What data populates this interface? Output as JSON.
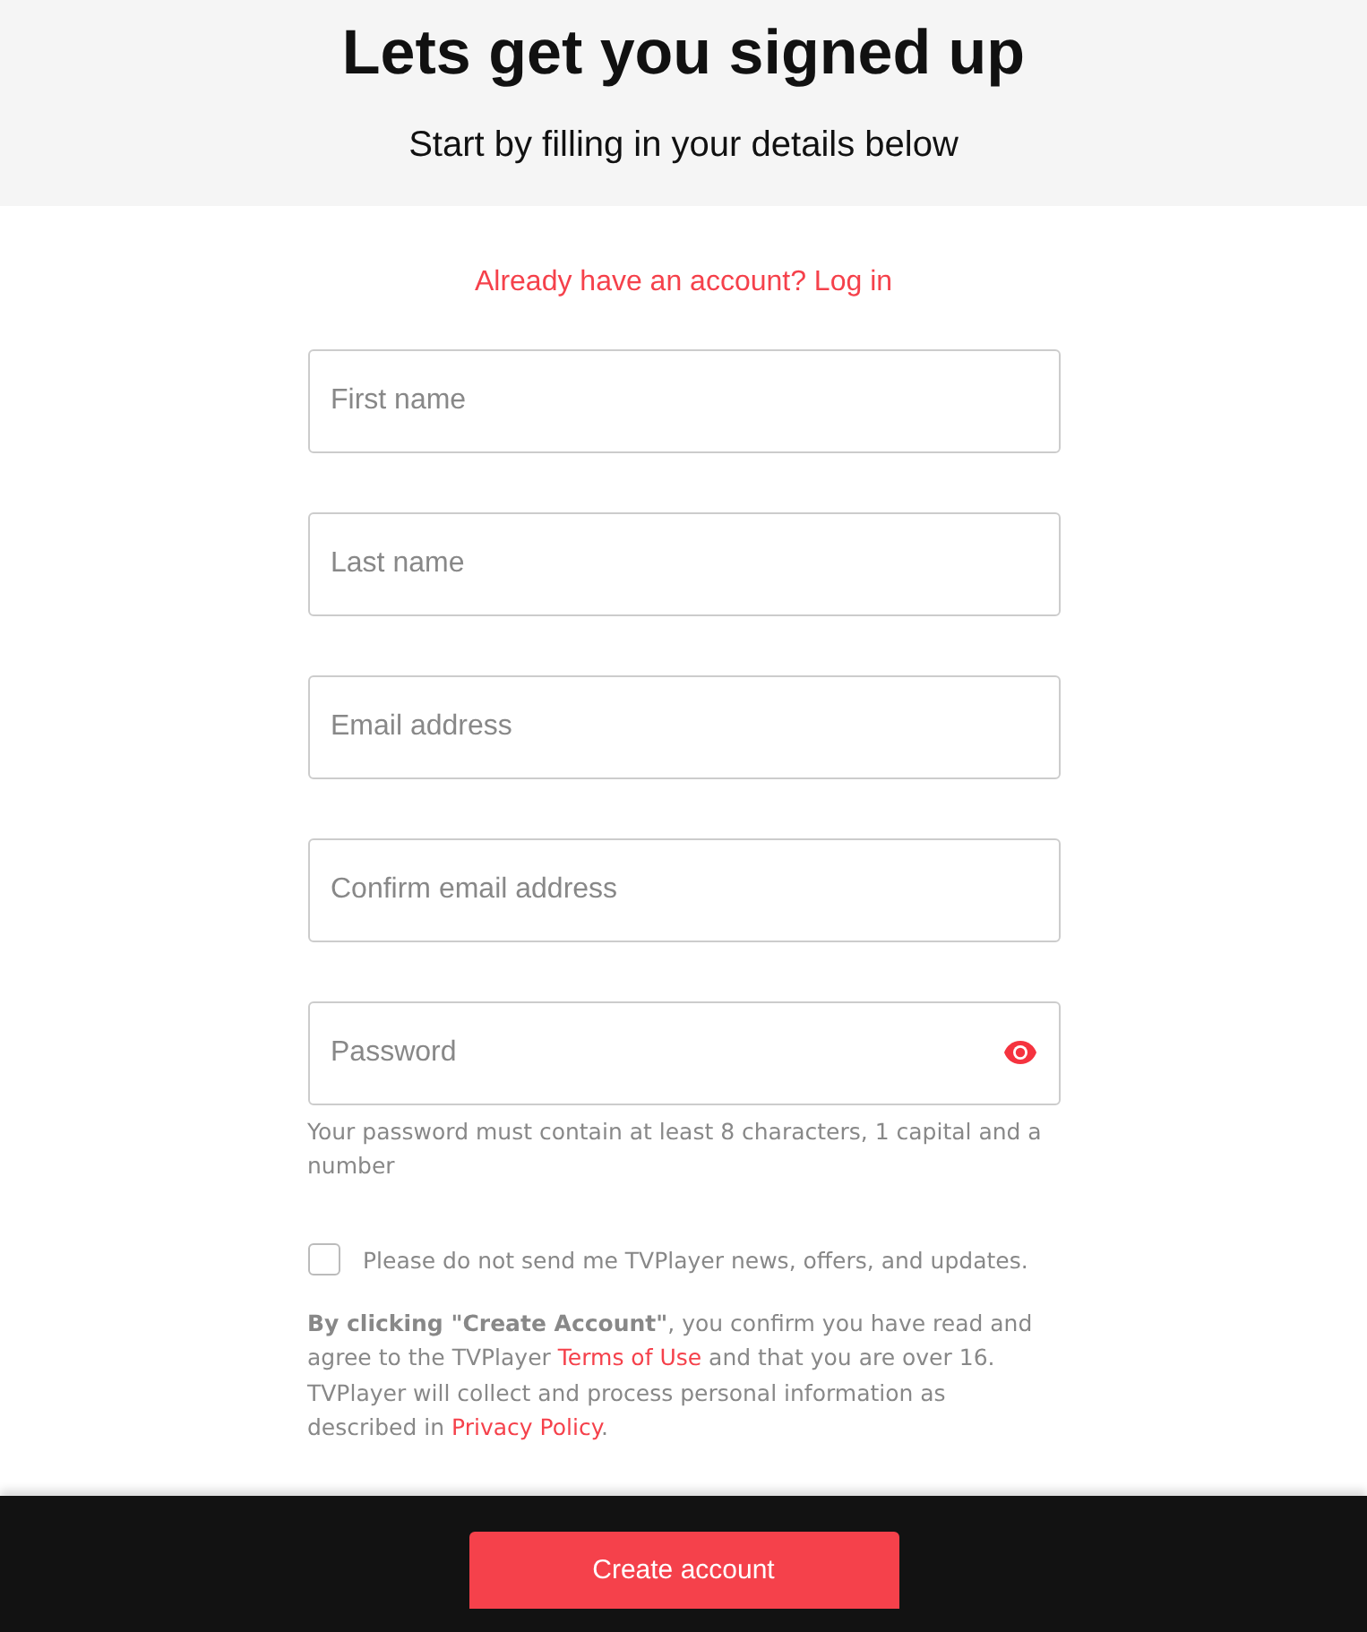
{
  "header": {
    "title": "Lets get you signed up",
    "subtitle": "Start by filling in your details below"
  },
  "login_link": "Already have an account? Log in",
  "fields": [
    {
      "kind": "text",
      "placeholder": "First name"
    },
    {
      "kind": "text",
      "placeholder": "Last name"
    },
    {
      "kind": "text",
      "placeholder": "Email address"
    },
    {
      "kind": "text",
      "placeholder": "Confirm email address"
    },
    {
      "kind": "password",
      "placeholder": "Password"
    }
  ],
  "password_hint": "Your password must contain at least 8 characters, 1 capital and a number",
  "opt_out": {
    "label": "Please do not send me TVPlayer news, offers, and updates.",
    "checked": false
  },
  "terms": [
    {
      "kind": "text",
      "text": "**By clicking \"Create Account\"**, you confirm you have read and agree to the TVPlayer "
    },
    {
      "kind": "link",
      "text": "Terms of Use"
    },
    {
      "kind": "text",
      "text": " and that you are over 16. TVPlayer will collect and process personal information as described in "
    },
    {
      "kind": "link",
      "text": "Privacy Policy"
    },
    {
      "kind": "text",
      "text": "."
    }
  ],
  "footer": {
    "button": "Create account"
  }
}
